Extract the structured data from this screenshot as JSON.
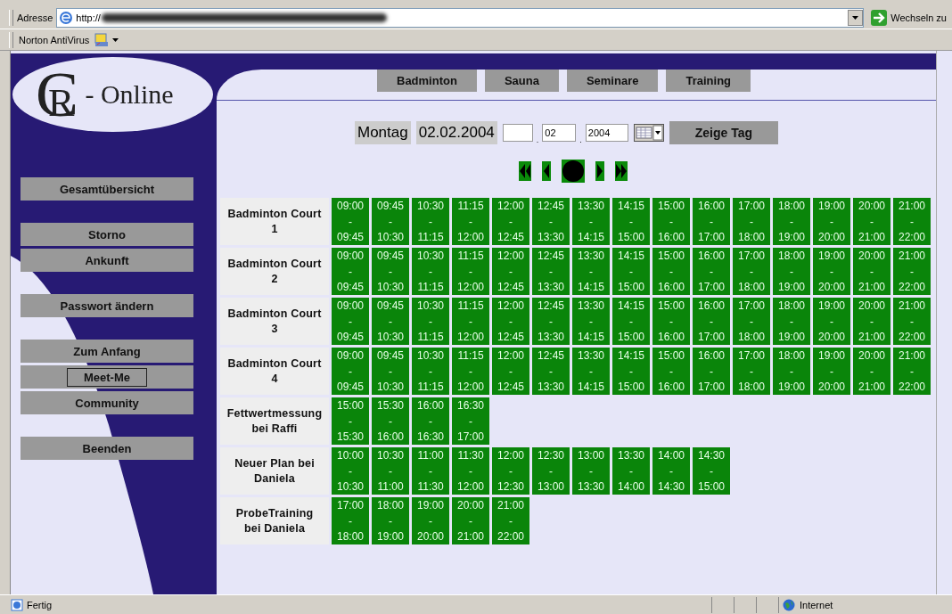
{
  "browser": {
    "address_label": "Adresse",
    "url": "http://",
    "go_button": "Wechseln zu",
    "toolbar_label": "Norton AntiVirus"
  },
  "logo": {
    "monogram": "CR",
    "text": "- Online"
  },
  "tabs": [
    {
      "label": "Badminton"
    },
    {
      "label": "Sauna"
    },
    {
      "label": "Seminare"
    },
    {
      "label": "Training"
    }
  ],
  "sidebar": {
    "groups": [
      [
        {
          "label": "Gesamtübersicht",
          "focused": false
        }
      ],
      [
        {
          "label": "Storno",
          "focused": false
        },
        {
          "label": "Ankunft",
          "focused": false
        }
      ],
      [
        {
          "label": "Passwort ändern",
          "focused": false
        }
      ],
      [
        {
          "label": "Zum Anfang",
          "focused": false
        },
        {
          "label": "Meet-Me",
          "focused": true
        },
        {
          "label": "Community",
          "focused": false
        }
      ],
      [
        {
          "label": "Beenden",
          "focused": false
        }
      ]
    ]
  },
  "date_bar": {
    "weekday": "Montag",
    "date": "02.02.2004",
    "month_value": "02",
    "year_value": "2004",
    "separators": [
      ".",
      "."
    ],
    "button": "Zeige Tag"
  },
  "day_nav": [
    {
      "kind": "first"
    },
    {
      "kind": "prev"
    },
    {
      "kind": "today"
    },
    {
      "kind": "next"
    },
    {
      "kind": "last"
    }
  ],
  "schedule": {
    "rows": [
      {
        "name": "Badminton Court 1",
        "slots": [
          [
            "09:00",
            "-",
            "09:45"
          ],
          [
            "09:45",
            "-",
            "10:30"
          ],
          [
            "10:30",
            "-",
            "11:15"
          ],
          [
            "11:15",
            "-",
            "12:00"
          ],
          [
            "12:00",
            "-",
            "12:45"
          ],
          [
            "12:45",
            "-",
            "13:30"
          ],
          [
            "13:30",
            "-",
            "14:15"
          ],
          [
            "14:15",
            "-",
            "15:00"
          ],
          [
            "15:00",
            "-",
            "16:00"
          ],
          [
            "16:00",
            "-",
            "17:00"
          ],
          [
            "17:00",
            "-",
            "18:00"
          ],
          [
            "18:00",
            "-",
            "19:00"
          ],
          [
            "19:00",
            "-",
            "20:00"
          ],
          [
            "20:00",
            "-",
            "21:00"
          ],
          [
            "21:00",
            "-",
            "22:00"
          ]
        ]
      },
      {
        "name": "Badminton Court 2",
        "slots": [
          [
            "09:00",
            "-",
            "09:45"
          ],
          [
            "09:45",
            "-",
            "10:30"
          ],
          [
            "10:30",
            "-",
            "11:15"
          ],
          [
            "11:15",
            "-",
            "12:00"
          ],
          [
            "12:00",
            "-",
            "12:45"
          ],
          [
            "12:45",
            "-",
            "13:30"
          ],
          [
            "13:30",
            "-",
            "14:15"
          ],
          [
            "14:15",
            "-",
            "15:00"
          ],
          [
            "15:00",
            "-",
            "16:00"
          ],
          [
            "16:00",
            "-",
            "17:00"
          ],
          [
            "17:00",
            "-",
            "18:00"
          ],
          [
            "18:00",
            "-",
            "19:00"
          ],
          [
            "19:00",
            "-",
            "20:00"
          ],
          [
            "20:00",
            "-",
            "21:00"
          ],
          [
            "21:00",
            "-",
            "22:00"
          ]
        ]
      },
      {
        "name": "Badminton Court 3",
        "slots": [
          [
            "09:00",
            "-",
            "09:45"
          ],
          [
            "09:45",
            "-",
            "10:30"
          ],
          [
            "10:30",
            "-",
            "11:15"
          ],
          [
            "11:15",
            "-",
            "12:00"
          ],
          [
            "12:00",
            "-",
            "12:45"
          ],
          [
            "12:45",
            "-",
            "13:30"
          ],
          [
            "13:30",
            "-",
            "14:15"
          ],
          [
            "14:15",
            "-",
            "15:00"
          ],
          [
            "15:00",
            "-",
            "16:00"
          ],
          [
            "16:00",
            "-",
            "17:00"
          ],
          [
            "17:00",
            "-",
            "18:00"
          ],
          [
            "18:00",
            "-",
            "19:00"
          ],
          [
            "19:00",
            "-",
            "20:00"
          ],
          [
            "20:00",
            "-",
            "21:00"
          ],
          [
            "21:00",
            "-",
            "22:00"
          ]
        ]
      },
      {
        "name": "Badminton Court 4",
        "slots": [
          [
            "09:00",
            "-",
            "09:45"
          ],
          [
            "09:45",
            "-",
            "10:30"
          ],
          [
            "10:30",
            "-",
            "11:15"
          ],
          [
            "11:15",
            "-",
            "12:00"
          ],
          [
            "12:00",
            "-",
            "12:45"
          ],
          [
            "12:45",
            "-",
            "13:30"
          ],
          [
            "13:30",
            "-",
            "14:15"
          ],
          [
            "14:15",
            "-",
            "15:00"
          ],
          [
            "15:00",
            "-",
            "16:00"
          ],
          [
            "16:00",
            "-",
            "17:00"
          ],
          [
            "17:00",
            "-",
            "18:00"
          ],
          [
            "18:00",
            "-",
            "19:00"
          ],
          [
            "19:00",
            "-",
            "20:00"
          ],
          [
            "20:00",
            "-",
            "21:00"
          ],
          [
            "21:00",
            "-",
            "22:00"
          ]
        ]
      },
      {
        "name": "Fettwertmessung bei Raffi",
        "slots": [
          [
            "15:00",
            "-",
            "15:30"
          ],
          [
            "15:30",
            "-",
            "16:00"
          ],
          [
            "16:00",
            "-",
            "16:30"
          ],
          [
            "16:30",
            "-",
            "17:00"
          ]
        ]
      },
      {
        "name": "Neuer Plan bei Daniela",
        "slots": [
          [
            "10:00",
            "-",
            "10:30"
          ],
          [
            "10:30",
            "-",
            "11:00"
          ],
          [
            "11:00",
            "-",
            "11:30"
          ],
          [
            "11:30",
            "-",
            "12:00"
          ],
          [
            "12:00",
            "-",
            "12:30"
          ],
          [
            "12:30",
            "-",
            "13:00"
          ],
          [
            "13:00",
            "-",
            "13:30"
          ],
          [
            "13:30",
            "-",
            "14:00"
          ],
          [
            "14:00",
            "-",
            "14:30"
          ],
          [
            "14:30",
            "-",
            "15:00"
          ]
        ]
      },
      {
        "name": "ProbeTraining bei Daniela",
        "slots": [
          [
            "17:00",
            "-",
            "18:00"
          ],
          [
            "18:00",
            "-",
            "19:00"
          ],
          [
            "19:00",
            "-",
            "20:00"
          ],
          [
            "20:00",
            "-",
            "21:00"
          ],
          [
            "21:00",
            "-",
            "22:00"
          ]
        ]
      }
    ]
  },
  "status_bar": {
    "text": "Fertig",
    "zone": "Internet"
  }
}
